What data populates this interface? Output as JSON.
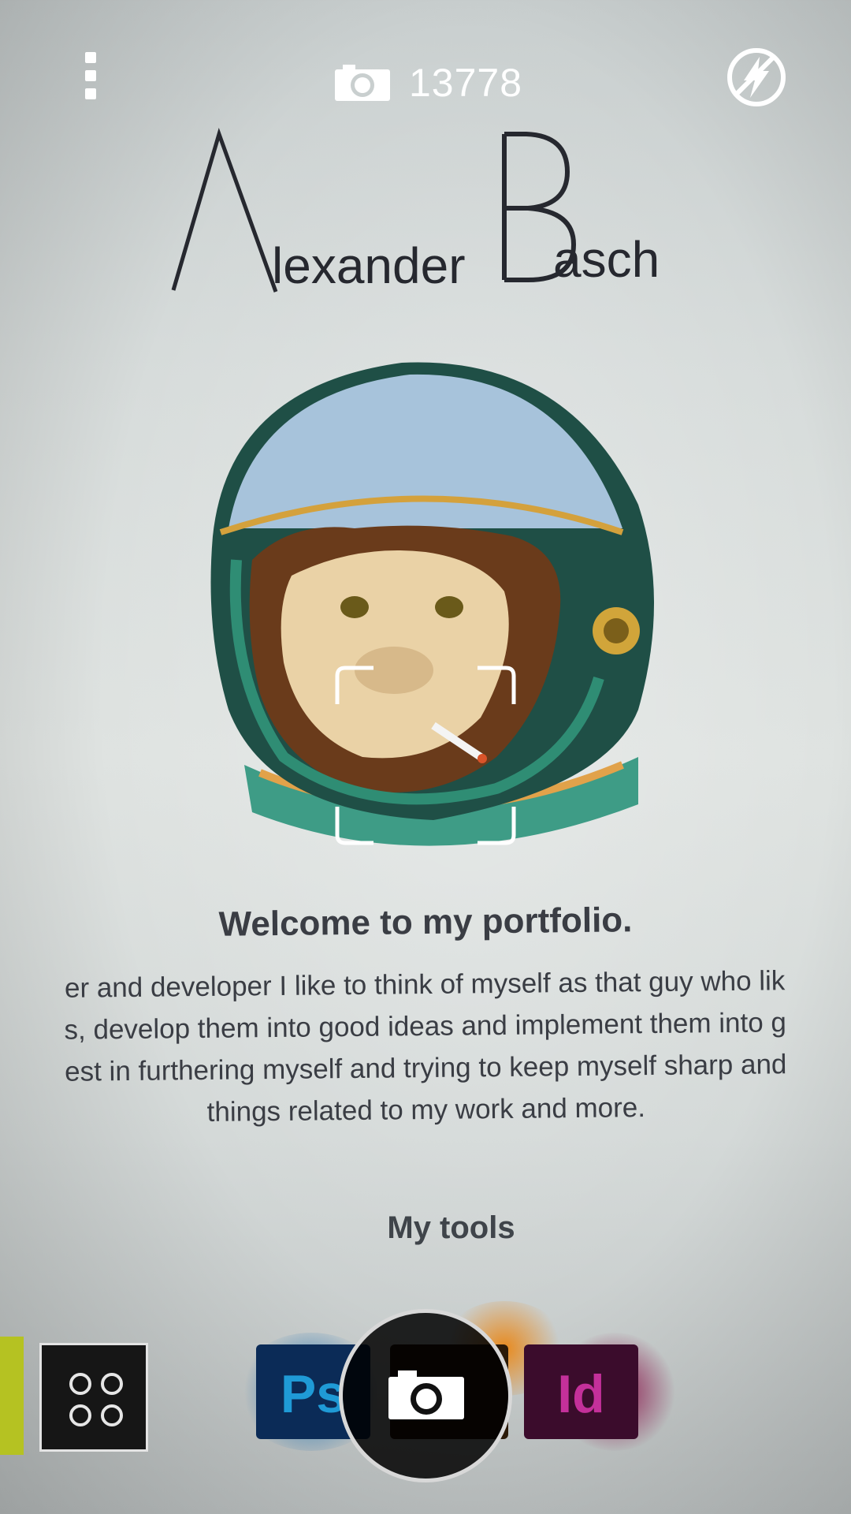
{
  "camera": {
    "menu_icon": "overflow-menu-icon",
    "counter_icon": "camera-icon",
    "shot_count": "13778",
    "flash_icon": "flash-auto-icon",
    "gallery_icon": "gallery-grid-icon",
    "shutter_icon": "camera-shutter-icon"
  },
  "page": {
    "logo_first": "lexander",
    "logo_second": "asch",
    "welcome": "Welcome to my portfolio.",
    "intro_lines": [
      "er and developer I like to think of myself as that guy who lik",
      "s, develop them into good ideas and implement them into g",
      "est in furthering myself and trying to keep myself sharp and",
      "things related to my work and more."
    ],
    "tools_heading": "My tools",
    "tools": [
      {
        "label": "Ps",
        "color": "#1f9ad6"
      },
      {
        "label": "",
        "color": "#ff9a00"
      },
      {
        "label": "Id",
        "color": "#c4309a"
      }
    ]
  }
}
